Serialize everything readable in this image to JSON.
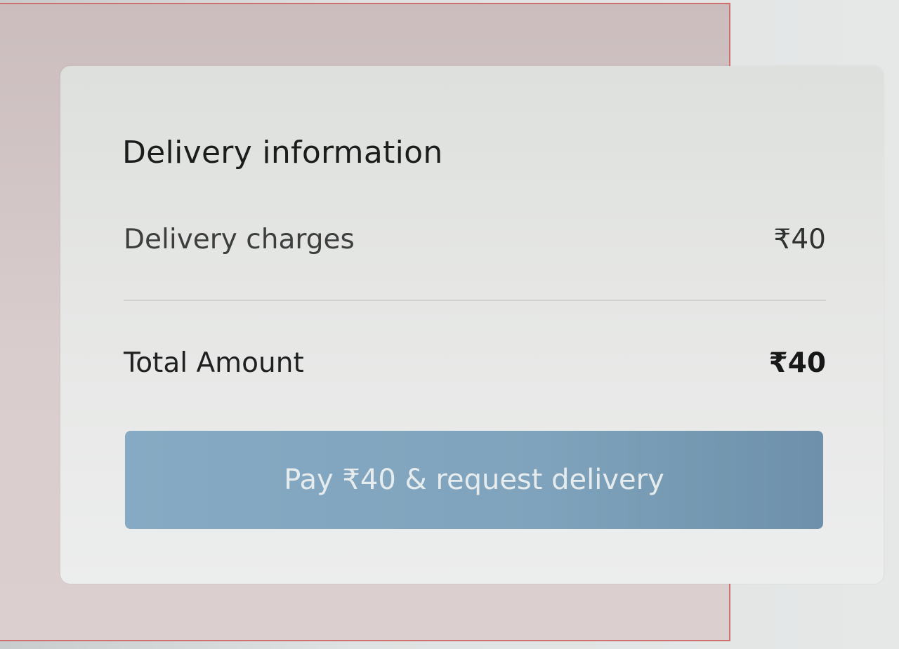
{
  "delivery_card": {
    "title": "Delivery information",
    "charges_label": "Delivery charges",
    "charges_value": "₹40",
    "total_label": "Total Amount",
    "total_value": "₹40",
    "pay_button_label": "Pay ₹40 & request delivery"
  },
  "colors": {
    "button": "#82a5bf",
    "button_text": "#e6ecee",
    "card": "#e6e7e5",
    "backdrop_border": "#cf6f6f"
  }
}
